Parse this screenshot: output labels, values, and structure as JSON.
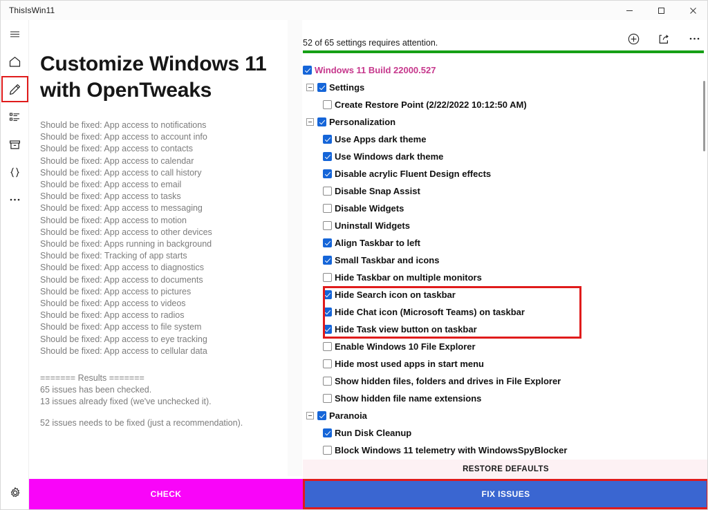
{
  "window": {
    "title": "ThisIsWin11",
    "minimize_label": "minimize",
    "maximize_label": "maximize",
    "close_label": "close"
  },
  "rail": {
    "items": [
      {
        "icon": "hamburger-menu-icon",
        "name": "menu"
      },
      {
        "icon": "home-icon",
        "name": "home"
      },
      {
        "icon": "pencil-icon",
        "name": "tweaks",
        "selected": true
      },
      {
        "icon": "list-icon",
        "name": "apps"
      },
      {
        "icon": "package-icon",
        "name": "packages"
      },
      {
        "icon": "braces-icon",
        "name": "scripts"
      },
      {
        "icon": "ellipsis-icon",
        "name": "more"
      }
    ],
    "gear": "settings-gear-icon"
  },
  "left": {
    "headline": "Customize Windows 11 with OpenTweaks",
    "issues": [
      "Should be fixed: App access to notifications",
      "Should be fixed: App access to account info",
      "Should be fixed: App access to contacts",
      "Should be fixed: App access to calendar",
      "Should be fixed: App access to call history",
      "Should be fixed: App access to email",
      "Should be fixed: App access to tasks",
      "Should be fixed: App access to messaging",
      "Should be fixed: App access to motion",
      "Should be fixed: App access to other devices",
      "Should be fixed: Apps running in background",
      "Should be fixed: Tracking of app starts",
      "Should be fixed: App access to diagnostics",
      "Should be fixed: App access to documents",
      "Should be fixed: App access to pictures",
      "Should be fixed: App access to videos",
      "Should be fixed: App access to radios",
      "Should be fixed: App access to file system",
      "Should be fixed: App access to eye tracking",
      "Should be fixed: App access to cellular data"
    ],
    "results_header": "======= Results =======",
    "results_lines": [
      "65 issues has been checked.",
      "13 issues already fixed (we've unchecked it)."
    ],
    "results_footer": "52 issues needs to be fixed (just a recommendation)."
  },
  "right": {
    "tools": [
      {
        "icon": "add-circle-icon",
        "name": "add"
      },
      {
        "icon": "share-icon",
        "name": "share"
      },
      {
        "icon": "ellipsis-icon",
        "name": "more-options"
      }
    ],
    "attention_text": "52 of 65 settings requires attention.",
    "progress_percent": 100,
    "progress_color": "#16a016",
    "root_label": "Windows 11 Build 22000.527",
    "root_color": "#c6378c",
    "root_checked": true,
    "groups": [
      {
        "label": "Settings",
        "checked": true,
        "expanded": true,
        "items": [
          {
            "label": "Create Restore Point (2/22/2022 10:12:50 AM)",
            "checked": false
          }
        ]
      },
      {
        "label": "Personalization",
        "checked": true,
        "expanded": true,
        "items": [
          {
            "label": "Use Apps dark theme",
            "checked": true
          },
          {
            "label": "Use Windows dark theme",
            "checked": true
          },
          {
            "label": "Disable acrylic Fluent Design effects",
            "checked": true
          },
          {
            "label": "Disable Snap Assist",
            "checked": false
          },
          {
            "label": "Disable Widgets",
            "checked": false
          },
          {
            "label": "Uninstall Widgets",
            "checked": false
          },
          {
            "label": "Align Taskbar to left",
            "checked": true
          },
          {
            "label": "Small Taskbar and icons",
            "checked": true
          },
          {
            "label": "Hide Taskbar on multiple monitors",
            "checked": false
          },
          {
            "label": "Hide Search icon on taskbar",
            "checked": true,
            "highlighted": true
          },
          {
            "label": "Hide Chat icon (Microsoft Teams) on taskbar",
            "checked": true,
            "highlighted": true
          },
          {
            "label": "Hide Task view button on taskbar",
            "checked": true,
            "highlighted": true
          },
          {
            "label": "Enable Windows 10 File Explorer",
            "checked": false
          },
          {
            "label": "Hide most used apps in start menu",
            "checked": false
          },
          {
            "label": "Show hidden files, folders and drives in File Explorer",
            "checked": false
          },
          {
            "label": "Show hidden file name extensions",
            "checked": false
          }
        ]
      },
      {
        "label": "Paranoia",
        "checked": true,
        "expanded": true,
        "items": [
          {
            "label": "Run Disk Cleanup",
            "checked": true
          },
          {
            "label": "Block Windows 11 telemetry with WindowsSpyBlocker",
            "checked": false
          }
        ]
      }
    ]
  },
  "bottom": {
    "check_label": "CHECK",
    "check_color": "#f905f9",
    "restore_label": "RESTORE DEFAULTS",
    "fix_label": "FIX ISSUES",
    "fix_color": "#3a66d1",
    "highlight_color": "#e01b1b"
  }
}
